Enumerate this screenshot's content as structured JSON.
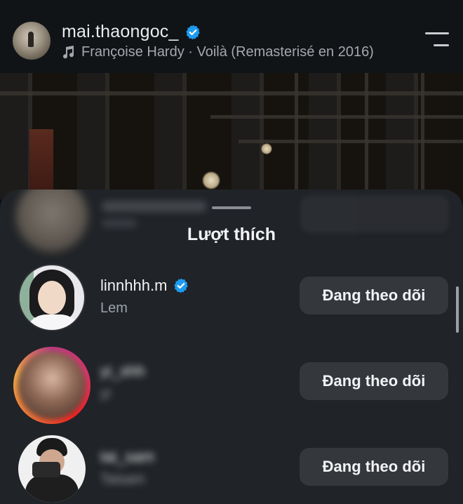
{
  "post": {
    "username": "mai.thaongoc_",
    "music": "Françoise Hardy · Voilà (Remasterisé en 2016)"
  },
  "sheet": {
    "title": "Lượt thích"
  },
  "likes": [
    {
      "username": "linnhhh.m",
      "subtitle": "Lem",
      "verified": true,
      "button": "Đang theo dõi"
    },
    {
      "username": "yi_shh",
      "subtitle": "yi",
      "verified": false,
      "button": "Đang theo dõi"
    },
    {
      "username": "tai_sam",
      "subtitle": "Taisam",
      "verified": false,
      "button": "Đang theo dõi"
    }
  ],
  "colors": {
    "verified_blue": "#1d9bf0",
    "button_bg": "#34373c",
    "sheet_bg": "#202327"
  },
  "icons": [
    "verified-badge-icon",
    "music-note-icon",
    "menu-icon"
  ]
}
